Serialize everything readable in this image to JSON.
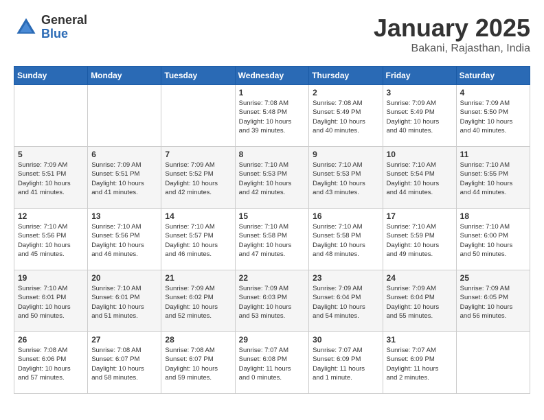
{
  "header": {
    "logo_general": "General",
    "logo_blue": "Blue",
    "month_title": "January 2025",
    "location": "Bakani, Rajasthan, India"
  },
  "calendar": {
    "days_of_week": [
      "Sunday",
      "Monday",
      "Tuesday",
      "Wednesday",
      "Thursday",
      "Friday",
      "Saturday"
    ],
    "weeks": [
      [
        {
          "day": "",
          "info": ""
        },
        {
          "day": "",
          "info": ""
        },
        {
          "day": "",
          "info": ""
        },
        {
          "day": "1",
          "info": "Sunrise: 7:08 AM\nSunset: 5:48 PM\nDaylight: 10 hours\nand 39 minutes."
        },
        {
          "day": "2",
          "info": "Sunrise: 7:08 AM\nSunset: 5:49 PM\nDaylight: 10 hours\nand 40 minutes."
        },
        {
          "day": "3",
          "info": "Sunrise: 7:09 AM\nSunset: 5:49 PM\nDaylight: 10 hours\nand 40 minutes."
        },
        {
          "day": "4",
          "info": "Sunrise: 7:09 AM\nSunset: 5:50 PM\nDaylight: 10 hours\nand 40 minutes."
        }
      ],
      [
        {
          "day": "5",
          "info": "Sunrise: 7:09 AM\nSunset: 5:51 PM\nDaylight: 10 hours\nand 41 minutes."
        },
        {
          "day": "6",
          "info": "Sunrise: 7:09 AM\nSunset: 5:51 PM\nDaylight: 10 hours\nand 41 minutes."
        },
        {
          "day": "7",
          "info": "Sunrise: 7:09 AM\nSunset: 5:52 PM\nDaylight: 10 hours\nand 42 minutes."
        },
        {
          "day": "8",
          "info": "Sunrise: 7:10 AM\nSunset: 5:53 PM\nDaylight: 10 hours\nand 42 minutes."
        },
        {
          "day": "9",
          "info": "Sunrise: 7:10 AM\nSunset: 5:53 PM\nDaylight: 10 hours\nand 43 minutes."
        },
        {
          "day": "10",
          "info": "Sunrise: 7:10 AM\nSunset: 5:54 PM\nDaylight: 10 hours\nand 44 minutes."
        },
        {
          "day": "11",
          "info": "Sunrise: 7:10 AM\nSunset: 5:55 PM\nDaylight: 10 hours\nand 44 minutes."
        }
      ],
      [
        {
          "day": "12",
          "info": "Sunrise: 7:10 AM\nSunset: 5:56 PM\nDaylight: 10 hours\nand 45 minutes."
        },
        {
          "day": "13",
          "info": "Sunrise: 7:10 AM\nSunset: 5:56 PM\nDaylight: 10 hours\nand 46 minutes."
        },
        {
          "day": "14",
          "info": "Sunrise: 7:10 AM\nSunset: 5:57 PM\nDaylight: 10 hours\nand 46 minutes."
        },
        {
          "day": "15",
          "info": "Sunrise: 7:10 AM\nSunset: 5:58 PM\nDaylight: 10 hours\nand 47 minutes."
        },
        {
          "day": "16",
          "info": "Sunrise: 7:10 AM\nSunset: 5:58 PM\nDaylight: 10 hours\nand 48 minutes."
        },
        {
          "day": "17",
          "info": "Sunrise: 7:10 AM\nSunset: 5:59 PM\nDaylight: 10 hours\nand 49 minutes."
        },
        {
          "day": "18",
          "info": "Sunrise: 7:10 AM\nSunset: 6:00 PM\nDaylight: 10 hours\nand 50 minutes."
        }
      ],
      [
        {
          "day": "19",
          "info": "Sunrise: 7:10 AM\nSunset: 6:01 PM\nDaylight: 10 hours\nand 50 minutes."
        },
        {
          "day": "20",
          "info": "Sunrise: 7:10 AM\nSunset: 6:01 PM\nDaylight: 10 hours\nand 51 minutes."
        },
        {
          "day": "21",
          "info": "Sunrise: 7:09 AM\nSunset: 6:02 PM\nDaylight: 10 hours\nand 52 minutes."
        },
        {
          "day": "22",
          "info": "Sunrise: 7:09 AM\nSunset: 6:03 PM\nDaylight: 10 hours\nand 53 minutes."
        },
        {
          "day": "23",
          "info": "Sunrise: 7:09 AM\nSunset: 6:04 PM\nDaylight: 10 hours\nand 54 minutes."
        },
        {
          "day": "24",
          "info": "Sunrise: 7:09 AM\nSunset: 6:04 PM\nDaylight: 10 hours\nand 55 minutes."
        },
        {
          "day": "25",
          "info": "Sunrise: 7:09 AM\nSunset: 6:05 PM\nDaylight: 10 hours\nand 56 minutes."
        }
      ],
      [
        {
          "day": "26",
          "info": "Sunrise: 7:08 AM\nSunset: 6:06 PM\nDaylight: 10 hours\nand 57 minutes."
        },
        {
          "day": "27",
          "info": "Sunrise: 7:08 AM\nSunset: 6:07 PM\nDaylight: 10 hours\nand 58 minutes."
        },
        {
          "day": "28",
          "info": "Sunrise: 7:08 AM\nSunset: 6:07 PM\nDaylight: 10 hours\nand 59 minutes."
        },
        {
          "day": "29",
          "info": "Sunrise: 7:07 AM\nSunset: 6:08 PM\nDaylight: 11 hours\nand 0 minutes."
        },
        {
          "day": "30",
          "info": "Sunrise: 7:07 AM\nSunset: 6:09 PM\nDaylight: 11 hours\nand 1 minute."
        },
        {
          "day": "31",
          "info": "Sunrise: 7:07 AM\nSunset: 6:09 PM\nDaylight: 11 hours\nand 2 minutes."
        },
        {
          "day": "",
          "info": ""
        }
      ]
    ]
  }
}
